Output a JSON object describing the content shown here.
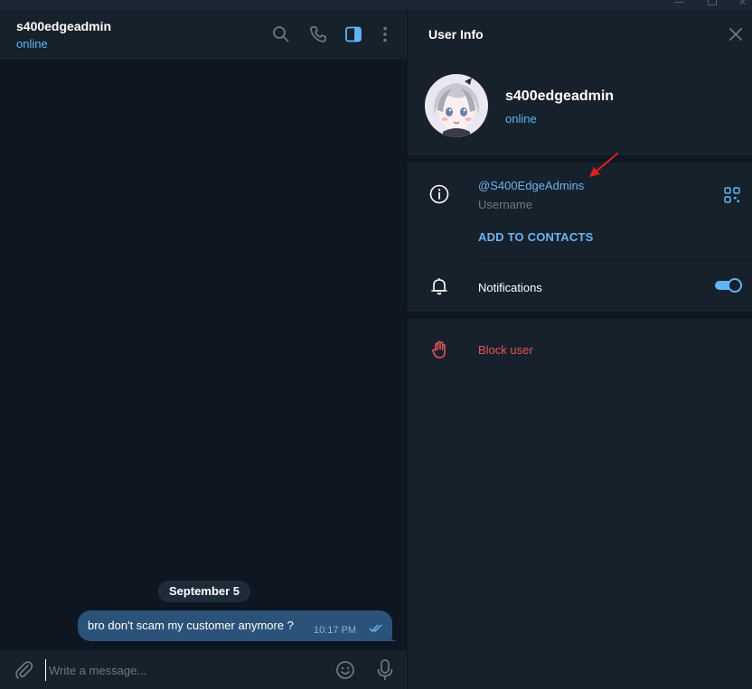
{
  "chat": {
    "name": "s400edgeadmin",
    "status": "online",
    "date_pill": "September 5",
    "message": {
      "text": "bro don't scam my customer anymore ?",
      "time": "10:17 PM"
    },
    "composer": {
      "placeholder": "Write a message..."
    }
  },
  "info": {
    "title": "User Info",
    "profile_name": "s400edgeadmin",
    "profile_status": "online",
    "username": "@S400EdgeAdmins",
    "username_label": "Username",
    "add_contacts": "ADD TO CONTACTS",
    "notifications_label": "Notifications",
    "notifications_on": true,
    "block_label": "Block user"
  },
  "colors": {
    "accent": "#5eb5f7",
    "link": "#6ab3f3",
    "danger": "#e5535a",
    "annotation_arrow": "#e02020"
  },
  "icons": [
    "search-icon",
    "phone-icon",
    "sidebar-toggle-icon",
    "more-vertical-icon",
    "close-icon",
    "info-icon",
    "qr-code-icon",
    "bell-icon",
    "hand-stop-icon",
    "attach-icon",
    "emoji-icon",
    "microphone-icon",
    "double-check-icon"
  ]
}
